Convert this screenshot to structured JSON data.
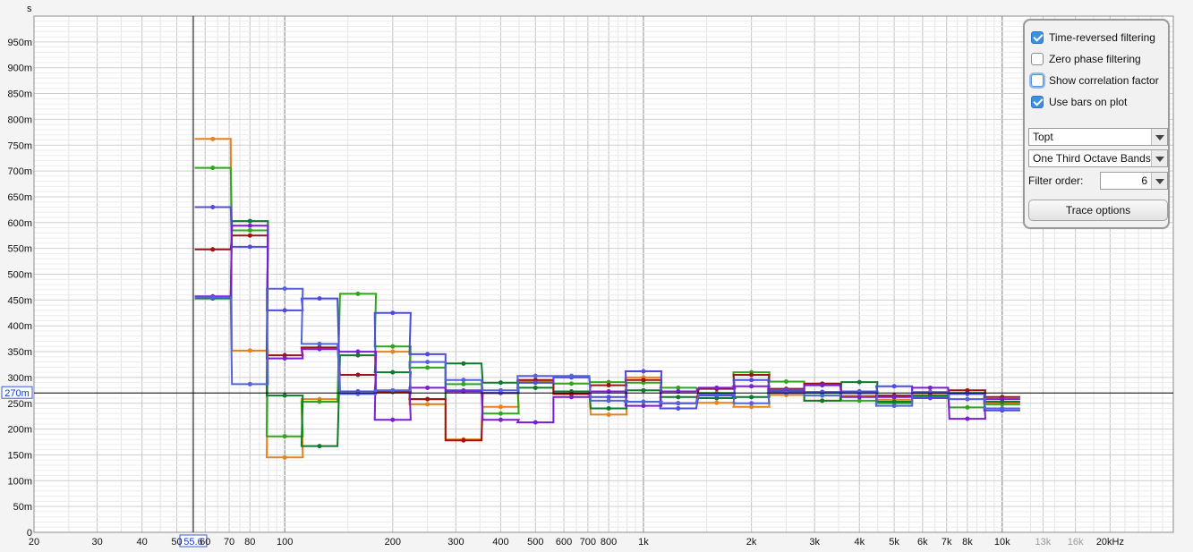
{
  "chart_data": {
    "type": "step",
    "title": "",
    "xlabel": "",
    "ylabel": "s",
    "x_scale": "log",
    "xlim": [
      20,
      30000
    ],
    "ylim": [
      0,
      1.0
    ],
    "x_ticks": [
      {
        "v": 20,
        "label": "20",
        "major": true
      },
      {
        "v": 30,
        "label": "30",
        "major": true
      },
      {
        "v": 40,
        "label": "40",
        "major": true
      },
      {
        "v": 50,
        "label": "50",
        "major": true
      },
      {
        "v": 60,
        "label": "60",
        "major": true
      },
      {
        "v": 70,
        "label": "70",
        "major": true
      },
      {
        "v": 80,
        "label": "80",
        "major": true
      },
      {
        "v": 100,
        "label": "100",
        "major": true
      },
      {
        "v": 200,
        "label": "200",
        "major": true
      },
      {
        "v": 300,
        "label": "300",
        "major": true
      },
      {
        "v": 400,
        "label": "400",
        "major": true
      },
      {
        "v": 500,
        "label": "500",
        "major": true
      },
      {
        "v": 600,
        "label": "600",
        "major": true
      },
      {
        "v": 700,
        "label": "700",
        "major": true
      },
      {
        "v": 800,
        "label": "800",
        "major": true
      },
      {
        "v": 1000,
        "label": "1k",
        "major": true
      },
      {
        "v": 2000,
        "label": "2k",
        "major": true
      },
      {
        "v": 3000,
        "label": "3k",
        "major": true
      },
      {
        "v": 4000,
        "label": "4k",
        "major": true
      },
      {
        "v": 5000,
        "label": "5k",
        "major": true
      },
      {
        "v": 6000,
        "label": "6k",
        "major": true
      },
      {
        "v": 7000,
        "label": "7k",
        "major": true
      },
      {
        "v": 8000,
        "label": "8k",
        "major": true
      },
      {
        "v": 10000,
        "label": "10k",
        "major": true
      },
      {
        "v": 13000,
        "label": "13k",
        "major": false
      },
      {
        "v": 16000,
        "label": "16k",
        "major": false
      },
      {
        "v": 20000,
        "label": "20kHz",
        "major": true
      }
    ],
    "y_ticks": [
      {
        "v": 0,
        "label": "0"
      },
      {
        "v": 0.05,
        "label": "50m"
      },
      {
        "v": 0.1,
        "label": "100m"
      },
      {
        "v": 0.15,
        "label": "150m"
      },
      {
        "v": 0.2,
        "label": "200m"
      },
      {
        "v": 0.25,
        "label": "250m"
      },
      {
        "v": 0.3,
        "label": "300m"
      },
      {
        "v": 0.35,
        "label": "350m"
      },
      {
        "v": 0.4,
        "label": "400m"
      },
      {
        "v": 0.45,
        "label": "450m"
      },
      {
        "v": 0.5,
        "label": "500m"
      },
      {
        "v": 0.55,
        "label": "550m"
      },
      {
        "v": 0.6,
        "label": "600m"
      },
      {
        "v": 0.65,
        "label": "650m"
      },
      {
        "v": 0.7,
        "label": "700m"
      },
      {
        "v": 0.75,
        "label": "750m"
      },
      {
        "v": 0.8,
        "label": "800m"
      },
      {
        "v": 0.85,
        "label": "850m"
      },
      {
        "v": 0.9,
        "label": "900m"
      },
      {
        "v": 0.95,
        "label": "950m"
      }
    ],
    "cursor": {
      "x": 55.6,
      "x_label": "55.6",
      "y": 0.27,
      "y_label": "270m"
    },
    "band_centers": [
      63,
      80,
      100,
      125,
      160,
      200,
      250,
      315,
      400,
      500,
      630,
      800,
      1000,
      1250,
      1600,
      2000,
      2500,
      3150,
      4000,
      5000,
      6300,
      8000,
      10000
    ],
    "series": [
      {
        "color": "#e8821e",
        "values": [
          0.762,
          0.352,
          0.145,
          0.258,
          0.273,
          0.35,
          0.248,
          0.18,
          0.243,
          0.293,
          0.268,
          0.228,
          0.3,
          0.25,
          0.251,
          0.243,
          0.266,
          0.255,
          0.265,
          0.257,
          0.27,
          0.258,
          0.251
        ]
      },
      {
        "color": "#2fa61c",
        "values": [
          0.706,
          0.585,
          0.186,
          0.253,
          0.462,
          0.36,
          0.319,
          0.287,
          0.23,
          0.29,
          0.288,
          0.291,
          0.29,
          0.28,
          0.27,
          0.31,
          0.292,
          0.27,
          0.255,
          0.25,
          0.262,
          0.242,
          0.248
        ]
      },
      {
        "color": "#0e7a2e",
        "values": [
          0.453,
          0.603,
          0.265,
          0.167,
          0.343,
          0.31,
          0.258,
          0.327,
          0.29,
          0.28,
          0.273,
          0.24,
          0.275,
          0.262,
          0.26,
          0.262,
          0.275,
          0.255,
          0.291,
          0.253,
          0.265,
          0.27,
          0.253
        ]
      },
      {
        "color": "#9a1414",
        "values": [
          0.548,
          0.575,
          0.343,
          0.358,
          0.305,
          0.272,
          0.258,
          0.178,
          0.27,
          0.295,
          0.268,
          0.285,
          0.295,
          0.25,
          0.278,
          0.305,
          0.278,
          0.288,
          0.272,
          0.265,
          0.27,
          0.275,
          0.262
        ]
      },
      {
        "color": "#4d4ddb",
        "values": [
          0.63,
          0.553,
          0.43,
          0.453,
          0.273,
          0.425,
          0.345,
          0.275,
          0.27,
          0.29,
          0.3,
          0.262,
          0.312,
          0.24,
          0.265,
          0.295,
          0.276,
          0.272,
          0.273,
          0.283,
          0.26,
          0.268,
          0.236
        ]
      },
      {
        "color": "#7a1ed6",
        "values": [
          0.457,
          0.594,
          0.337,
          0.355,
          0.35,
          0.218,
          0.28,
          0.273,
          0.218,
          0.213,
          0.262,
          0.273,
          0.245,
          0.273,
          0.28,
          0.283,
          0.272,
          0.285,
          0.262,
          0.262,
          0.28,
          0.22,
          0.258
        ]
      },
      {
        "color": "#5563d8",
        "values": [
          0.455,
          0.287,
          0.472,
          0.365,
          0.268,
          0.275,
          0.33,
          0.295,
          0.275,
          0.303,
          0.303,
          0.255,
          0.253,
          0.25,
          0.268,
          0.25,
          0.27,
          0.265,
          0.27,
          0.245,
          0.272,
          0.258,
          0.24
        ]
      }
    ]
  },
  "options": {
    "time_reversed_label": "Time-reversed filtering",
    "time_reversed_checked": true,
    "zero_phase_label": "Zero phase filtering",
    "zero_phase_checked": false,
    "show_correlation_label": "Show correlation factor",
    "show_correlation_checked": false,
    "use_bars_label": "Use bars on plot",
    "use_bars_checked": true,
    "metric_select_value": "Topt",
    "bands_select_value": "One Third Octave Bands",
    "filter_order_label": "Filter order:",
    "filter_order_value": "6",
    "trace_options_label": "Trace options"
  }
}
